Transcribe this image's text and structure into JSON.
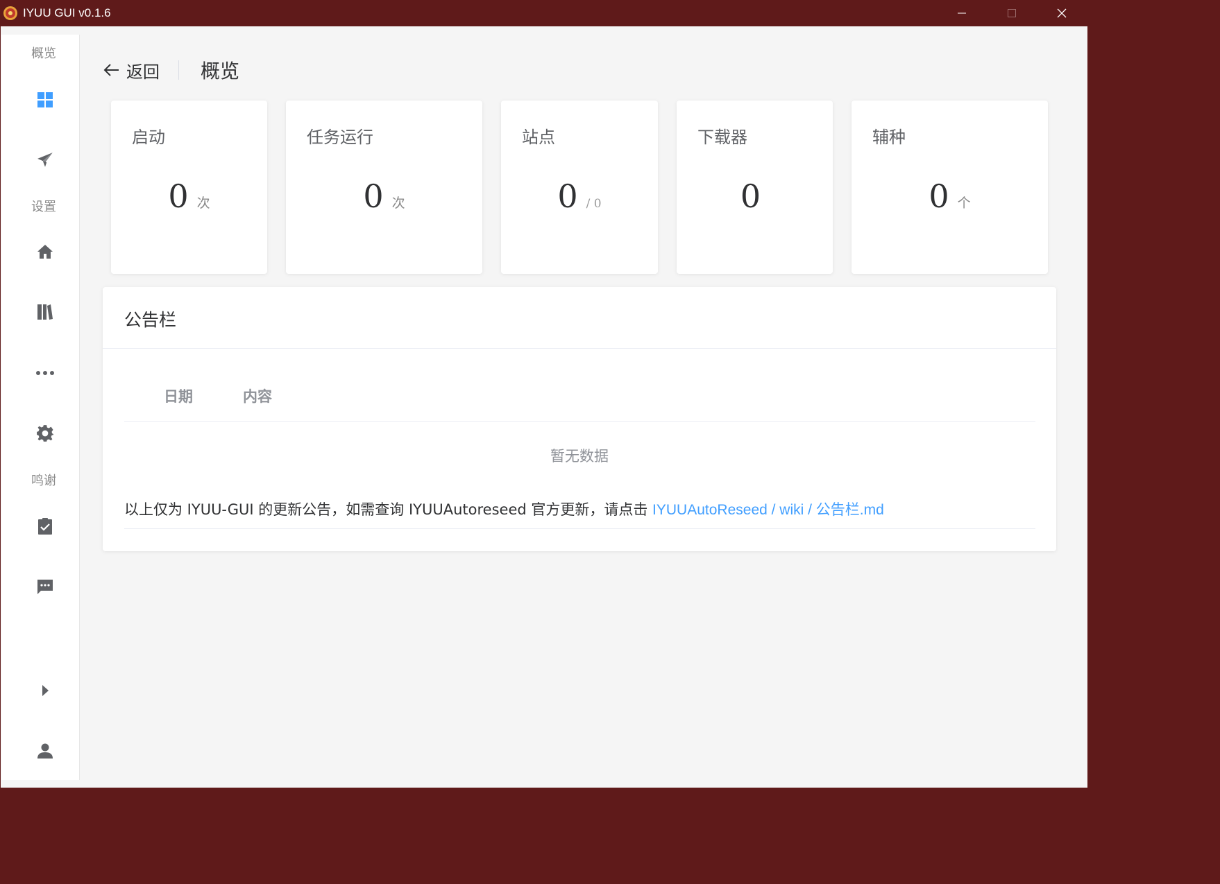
{
  "window": {
    "title": "IYUU GUI v0.1.6"
  },
  "sidebar": {
    "group_overview": "概览",
    "group_settings": "设置",
    "group_thanks": "鸣谢"
  },
  "header": {
    "back_label": "返回",
    "page_title": "概览"
  },
  "stats": [
    {
      "title": "启动",
      "value": "0",
      "unit": "次"
    },
    {
      "title": "任务运行",
      "value": "0",
      "unit": "次"
    },
    {
      "title": "站点",
      "value": "0",
      "unit": "/ 0"
    },
    {
      "title": "下载器",
      "value": "0",
      "unit": ""
    },
    {
      "title": "辅种",
      "value": "0",
      "unit": "个"
    }
  ],
  "board": {
    "title": "公告栏",
    "columns": [
      "日期",
      "内容"
    ],
    "empty_text": "暂无数据",
    "note_text": "以上仅为 IYUU-GUI 的更新公告，如需查询 IYUUAutoreseed 官方更新，请点击 ",
    "note_link": "IYUUAutoReseed / wiki / 公告栏.md"
  },
  "colors": {
    "titlebar": "#5f1a1a",
    "accent": "#409eff",
    "active_icon": "#409eff",
    "icon": "#606266"
  }
}
